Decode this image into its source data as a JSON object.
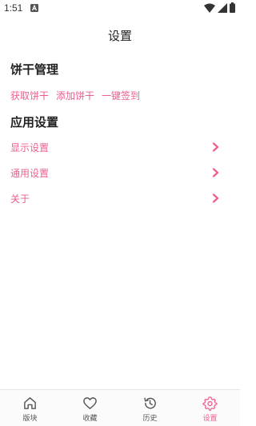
{
  "status_bar": {
    "time": "1:51"
  },
  "header": {
    "title": "设置"
  },
  "cookie_section": {
    "title": "饼干管理",
    "actions": [
      "获取饼干",
      "添加饼干",
      "一键签到"
    ]
  },
  "app_section": {
    "title": "应用设置",
    "items": [
      {
        "label": "显示设置",
        "icon": "chevron-right-icon"
      },
      {
        "label": "通用设置",
        "icon": "chevron-right-icon"
      },
      {
        "label": "关于",
        "icon": "chevron-right-icon"
      }
    ]
  },
  "tab_bar": {
    "tabs": [
      {
        "label": "版块",
        "icon": "home-icon"
      },
      {
        "label": "收藏",
        "icon": "heart-icon"
      },
      {
        "label": "历史",
        "icon": "history-icon"
      },
      {
        "label": "设置",
        "icon": "gear-icon"
      }
    ],
    "active_tab": "设置"
  },
  "colors": {
    "accent": "#ec5f8c",
    "text": "#222222",
    "muted": "#555555"
  }
}
